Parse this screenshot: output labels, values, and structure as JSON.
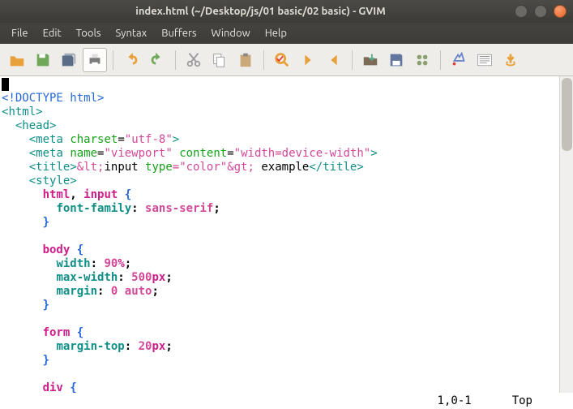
{
  "window": {
    "title": "index.html (~/Desktop/js/01 basic/02 basic) - GVIM"
  },
  "menu": {
    "items": [
      "File",
      "Edit",
      "Tools",
      "Syntax",
      "Buffers",
      "Window",
      "Help"
    ]
  },
  "toolbar": {
    "buttons": [
      {
        "name": "open",
        "color": "#e8a13a"
      },
      {
        "name": "save",
        "color": "#6fa858"
      },
      {
        "name": "save-all",
        "color": "#5a6c86"
      },
      {
        "name": "print",
        "color": "#7a7a7a",
        "raised": true
      },
      {
        "sep": true
      },
      {
        "name": "undo",
        "color": "#e8a13a"
      },
      {
        "name": "redo",
        "color": "#6fa858"
      },
      {
        "sep": true
      },
      {
        "name": "cut",
        "color": "#9a9a9a"
      },
      {
        "name": "copy",
        "color": "#9a9a9a"
      },
      {
        "name": "paste",
        "color": "#caa87a"
      },
      {
        "sep": true
      },
      {
        "name": "find-replace",
        "color": "#e8a13a"
      },
      {
        "name": "find-next",
        "color": "#e8a13a"
      },
      {
        "name": "find-prev",
        "color": "#e8a13a"
      },
      {
        "sep": true
      },
      {
        "name": "load-session",
        "color": "#7b6a55"
      },
      {
        "name": "save-session",
        "color": "#6276a0"
      },
      {
        "name": "run-script",
        "color": "#8aa06f"
      },
      {
        "sep": true
      },
      {
        "name": "make",
        "color": "#6a86c8"
      },
      {
        "name": "shell",
        "color": "#888"
      },
      {
        "name": "tags",
        "color": "#e8a13a"
      }
    ]
  },
  "status": {
    "pos": "1,0-1",
    "scroll": "Top"
  },
  "code": {
    "l1": "<!DOCTYPE html>",
    "l2_open": "<",
    "l2_tag": "html",
    "l2_close": ">",
    "l3": "head",
    "l4_tag": "meta",
    "l4_a1": "charset",
    "l4_v1": "\"utf-8\"",
    "l5_tag": "meta",
    "l5_a1": "name",
    "l5_v1": "\"viewport\"",
    "l5_a2": "content",
    "l5_v2": "\"width=device-width\"",
    "l6_tag": "title",
    "l6_e1": "&lt;",
    "l6_t1": "input ",
    "l6_a1": "type",
    "l6_v1": "=\"color\"",
    "l6_e2": "&gt;",
    "l6_t2": " example",
    "l7_tag": "style",
    "s1_sela": "html",
    "s1_comma": ", ",
    "s1_selb": "input",
    "s1_p1": "font-family",
    "s1_v1": "sans-serif",
    "s2_sel": "body",
    "s2_p1": "width",
    "s2_v1": "90",
    "s2_u1": "%",
    "s2_p2": "max-width",
    "s2_v2": "500",
    "s2_u2": "px",
    "s2_p3": "margin",
    "s2_v3a": "0",
    "s2_v3b": "auto",
    "s3_sel": "form",
    "s3_p1": "margin-top",
    "s3_v1": "20",
    "s3_u1": "px",
    "s4_sel": "div"
  }
}
